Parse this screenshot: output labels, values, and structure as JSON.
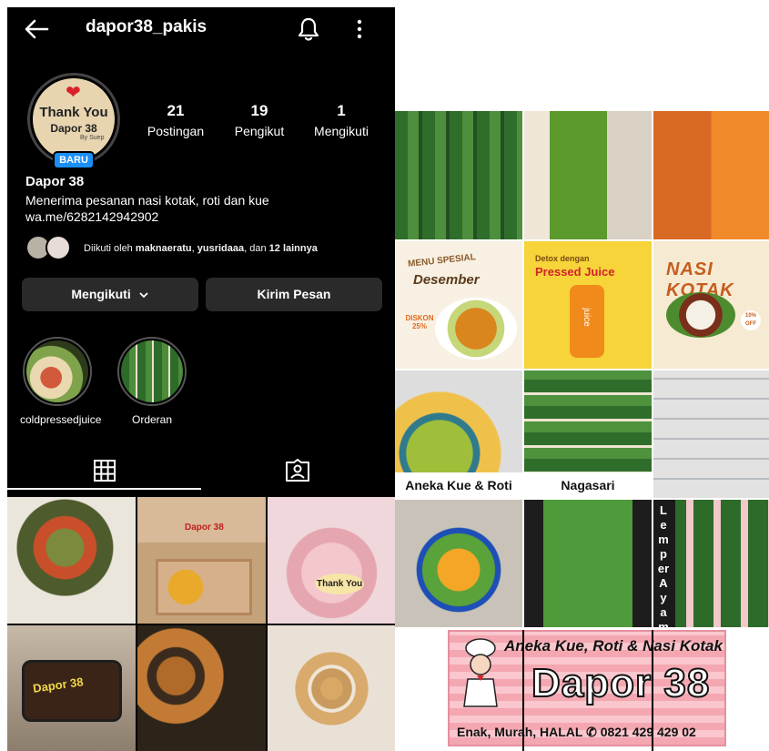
{
  "profile": {
    "username": "dapor38_pakis",
    "avatar": {
      "line1": "Thank You",
      "line2": "Dapor 38",
      "line3": "By Suep",
      "badge": "BARU"
    },
    "stats": [
      {
        "value": "21",
        "label": "Postingan"
      },
      {
        "value": "19",
        "label": "Pengikut"
      },
      {
        "value": "1",
        "label": "Mengikuti"
      }
    ],
    "display_name": "Dapor 38",
    "bio": "Menerima pesanan nasi kotak, roti dan kue",
    "link": "wa.me/6282142942902",
    "followed_by": {
      "prefix": "Diikuti oleh ",
      "user1": "maknaeratu",
      "sep": ", ",
      "user2": "yusridaaa",
      "mid": ", dan ",
      "others": "12 lainnya"
    },
    "buttons": {
      "following": "Mengikuti",
      "message": "Kirim Pesan"
    },
    "highlights": [
      {
        "label": "coldpressedjuice"
      },
      {
        "label": "Orderan"
      }
    ],
    "posts": [
      {
        "text": ""
      },
      {
        "text": "Dapor 38"
      },
      {
        "text": "Thank You"
      },
      {
        "text": "Dapor 38"
      },
      {
        "text": ""
      },
      {
        "text": ""
      }
    ]
  },
  "collage": {
    "promo": {
      "title1": "MENU SPESIAL",
      "title2": "Desember",
      "discount": "DISKON 25%"
    },
    "juice": {
      "title1": "Detox dengan",
      "title2": "Pressed Juice",
      "bottle": "juice"
    },
    "nasi": {
      "title": "NASI KOTAK",
      "badge": "10% OFF"
    },
    "labels": {
      "kue": "Aneka Kue & Roti",
      "nagasari": "Nagasari",
      "lemper": "Lemper Ayam"
    },
    "banner": {
      "top": "Aneka Kue, Roti & Nasi Kotak",
      "main": "Dapor 38",
      "bottom": "Enak, Murah, HALAL  ✆ 0821 429 429 02"
    }
  }
}
